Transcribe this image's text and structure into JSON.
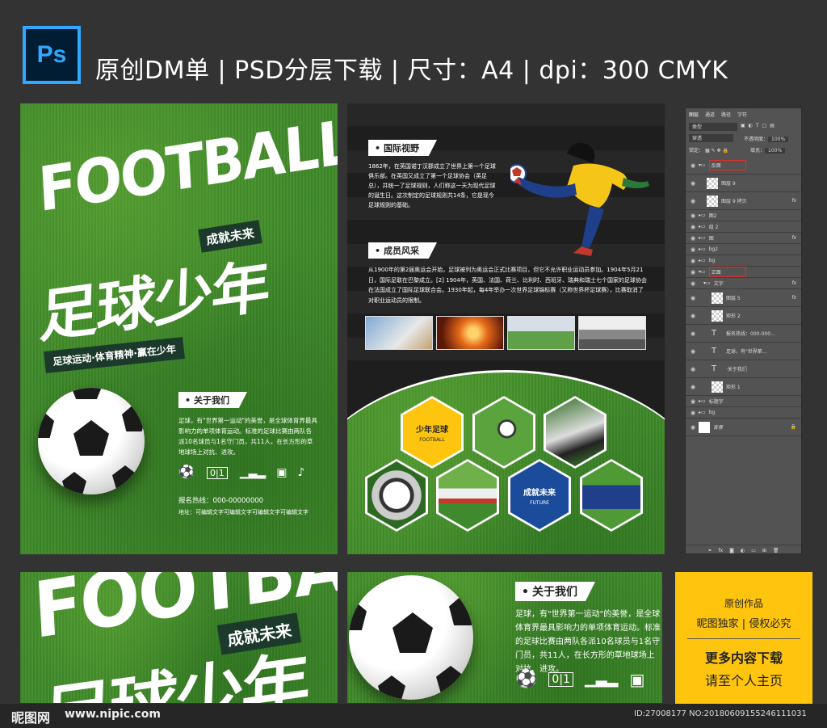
{
  "header": {
    "logo_text": "Ps",
    "title": "原创DM单 | PSD分层下载 | 尺寸：A4 | dpi：300   CMYK"
  },
  "front": {
    "football_word": "FOOTBALL",
    "tag_achieve": "成就未来",
    "title_cn": "足球少年",
    "slogan": "足球运动·体育精神·赢在少年",
    "about_label": "关于我们",
    "about_text": "足球，有\"世界第一运动\"的美誉，是全球体育界最具影响力的单项体育运动。标准的足球比赛由两队各派10名球员与1名守门员，共11人，在长方形的草地球场上对抗、进攻。",
    "hotline": "报名热线：000-00000000",
    "address": "地址：可编辑文字可编辑文字可编辑文字可编辑文字",
    "score_icon": "0|1"
  },
  "back": {
    "intl_label": "国际视野",
    "intl_text": "1862年，在英国诺丁汉郡成立了世界上第一个足球俱乐部。在英国又成立了第一个足球协会（英足总），并统一了足球规则，人们称这一天为现代足球的诞生日。这次制定的足球规则共14条，它是现今足球规则的基础。",
    "members_label": "成员风采",
    "members_text": "从1900年的第2届奥运会开始，足球被列为奥运会正式比赛项目，但它不允许职业运动员参加。1904年5月21日，国际足联在巴黎成立。[2] 1904年，英国、法国、荷兰、比利时、西班牙、瑞典和瑞士七个国家的足球协会在法国成立了国际足球联合会。1930年起，每4年举办一次世界足球锦标赛（又称世界杯足球赛），比赛取消了对职业运动员的限制。",
    "hex_yellow_title": "少年足球",
    "hex_yellow_sub": "FOOTBALL",
    "hex_blue_title": "成就未来",
    "hex_blue_sub": "FUTURE"
  },
  "layers": {
    "tabs": [
      "图层",
      "通道",
      "路径",
      "字符"
    ],
    "kind": "类型",
    "blend": "穿透",
    "opacity_label": "不透明度：",
    "opacity": "100%",
    "lock_label": "锁定：",
    "fill_label": "填充：",
    "fill": "100%",
    "rows": [
      {
        "name": "反面",
        "type": "group-open",
        "highlight": true
      },
      {
        "name": "图层 9",
        "type": "pixel"
      },
      {
        "name": "图层 9 拷贝",
        "type": "pixel",
        "fx": "fx"
      },
      {
        "name": "图2",
        "type": "group"
      },
      {
        "name": "组 2",
        "type": "group"
      },
      {
        "name": "图",
        "type": "group",
        "fx": "fx"
      },
      {
        "name": "bg2",
        "type": "group"
      },
      {
        "name": "bg",
        "type": "group"
      },
      {
        "name": "正面",
        "type": "group-open",
        "highlight": true
      },
      {
        "name": "文字",
        "type": "group-open",
        "fx": "fx"
      },
      {
        "name": "图层 5",
        "type": "pixel",
        "fx": "fx"
      },
      {
        "name": "矩形 2",
        "type": "pixel"
      },
      {
        "name": "报名热线：000-000...",
        "type": "text"
      },
      {
        "name": "足球，有\"世界第...",
        "type": "text"
      },
      {
        "name": "·关于我们",
        "type": "text"
      },
      {
        "name": "矩形 1",
        "type": "pixel"
      },
      {
        "name": "标题字",
        "type": "group"
      },
      {
        "name": "bg",
        "type": "group"
      },
      {
        "name": "背景",
        "type": "background"
      }
    ]
  },
  "preview": {
    "about_label": "关于我们",
    "about_text": "足球，有\"世界第一运动\"的美誉，是全球体育界最具影响力的单项体育运动。标准的足球比赛由两队各派10名球员与1名守门员，共11人，在长方形的草地球场上对抗、进攻。"
  },
  "promo": {
    "line1": "原创作品",
    "line2": "昵图独家 | 侵权必究",
    "line3": "更多内容下载",
    "line4": "请至个人主页"
  },
  "footer": {
    "site_logo": "昵图网",
    "site_url": "www.nipic.com",
    "id_text": "ID:27008177 NO:20180609155246111031"
  },
  "colors": {
    "grass": "#3f8a2a",
    "dark": "#1e1e1e",
    "yellow": "#ffc40d",
    "blue": "#1b4b9b",
    "ps_blue": "#31a8ff"
  }
}
